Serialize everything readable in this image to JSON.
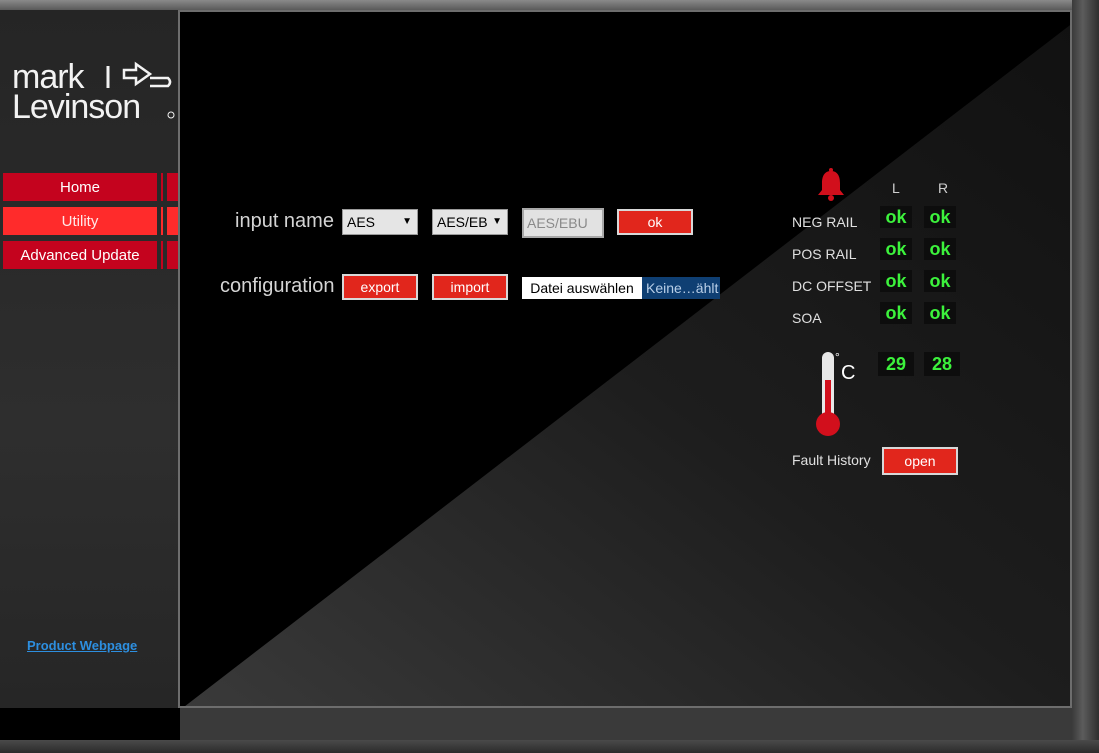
{
  "brand": {
    "logo_line1": "mark",
    "logo_line2": "Levinson"
  },
  "nav": {
    "items": [
      {
        "label": "Home"
      },
      {
        "label": "Utility"
      },
      {
        "label": "Advanced Update"
      }
    ],
    "product_link": "Product Webpage"
  },
  "form": {
    "input_name_label": "input name",
    "select1_value": "AES",
    "select2_value": "AES/EB",
    "name_input_value": "AES/EBU",
    "ok_label": "ok",
    "configuration_label": "configuration",
    "export_label": "export",
    "import_label": "import",
    "file_button_label": "Datei auswählen",
    "file_status": "Keine…ählt"
  },
  "status": {
    "col_left": "L",
    "col_right": "R",
    "rows": [
      {
        "label": "NEG RAIL",
        "left": "ok",
        "right": "ok"
      },
      {
        "label": "POS RAIL",
        "left": "ok",
        "right": "ok"
      },
      {
        "label": "DC OFFSET",
        "left": "ok",
        "right": "ok"
      },
      {
        "label": "SOA",
        "left": "ok",
        "right": "ok"
      }
    ],
    "temperature": {
      "unit_deg": "°",
      "unit_c": "C",
      "left": "29",
      "right": "28"
    },
    "fault_history_label": "Fault History",
    "open_label": "open"
  },
  "colors": {
    "accent_red": "#e1261c",
    "nav_red": "#c4031e",
    "nav_active": "#ff2b2b",
    "ok_green": "#3cf23c",
    "link_blue": "#2d8fe0"
  }
}
